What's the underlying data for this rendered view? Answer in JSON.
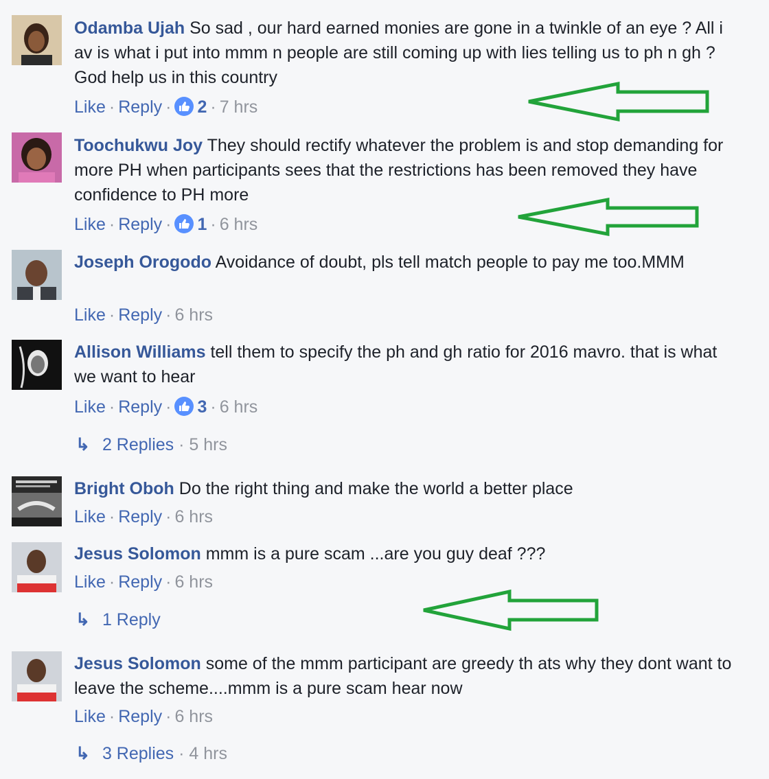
{
  "comments": [
    {
      "author": "Odamba Ujah",
      "text": "So sad , our hard earned monies are gone in a twinkle of an eye ? All i av is what i put into mmm n people are still coming up with lies telling us to ph n gh ? God help us in this country",
      "like_label": "Like",
      "reply_label": "Reply",
      "likes": "2",
      "time": "7 hrs"
    },
    {
      "author": "Toochukwu Joy",
      "text": "They should rectify whatever the problem is and stop demanding for more PH when participants sees that the restrictions has been removed they have confidence to PH more",
      "like_label": "Like",
      "reply_label": "Reply",
      "likes": "1",
      "time": "6 hrs"
    },
    {
      "author": "Joseph Orogodo",
      "text": "Avoidance of doubt, pls tell match people to pay me too.MMM",
      "like_label": "Like",
      "reply_label": "Reply",
      "time": "6 hrs"
    },
    {
      "author": "Allison Williams",
      "text": "tell them to specify the ph and gh ratio for 2016 mavro. that is what we want to hear",
      "like_label": "Like",
      "reply_label": "Reply",
      "likes": "3",
      "time": "6 hrs",
      "replies": "2 Replies",
      "replies_time": "5 hrs"
    },
    {
      "author": "Bright Oboh",
      "text": "Do the right thing and make the world a better place",
      "like_label": "Like",
      "reply_label": "Reply",
      "time": "6 hrs"
    },
    {
      "author": "Jesus Solomon",
      "text": "mmm is a pure scam ...are you guy deaf ???",
      "like_label": "Like",
      "reply_label": "Reply",
      "time": "6 hrs",
      "replies": "1 Reply"
    },
    {
      "author": "Jesus Solomon",
      "text": "some of the mmm participant are greedy th ats why they dont want to leave the scheme....mmm is a pure scam hear now",
      "like_label": "Like",
      "reply_label": "Reply",
      "time": "6 hrs",
      "replies": "3 Replies",
      "replies_time": "4 hrs"
    }
  ],
  "colors": {
    "author": "#365899",
    "link": "#4267b2",
    "muted": "#90949c",
    "annotation_arrow": "#22a33a"
  },
  "icons": {
    "like_badge": "thumbs-up-icon",
    "reply_arrow": "reply-arrow-icon",
    "annotation": "green-arrow-icon"
  }
}
